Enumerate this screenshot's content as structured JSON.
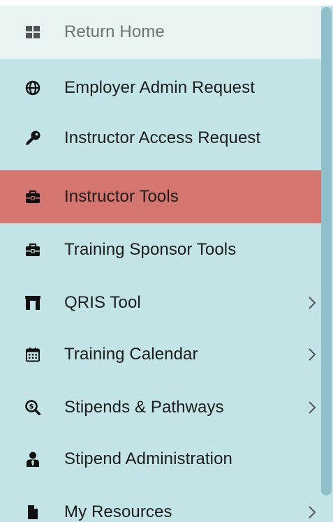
{
  "colors": {
    "menu_bg": "#c3e4e6",
    "home_bg": "#e8f3f4",
    "active_bg": "#d57570",
    "text": "#1c1c1c",
    "home_text": "#6e7475",
    "scrollbar_thumb": "#8fc0c9"
  },
  "menu": {
    "items": [
      {
        "label": "Return Home",
        "icon": "grid-icon",
        "state": "home"
      },
      {
        "label": "Employer Admin Request",
        "icon": "globe-icon"
      },
      {
        "label": "Instructor Access Request",
        "icon": "key-icon"
      },
      {
        "label": "Instructor Tools",
        "icon": "toolbox-icon",
        "state": "active"
      },
      {
        "label": "Training Sponsor Tools",
        "icon": "toolbox-icon"
      },
      {
        "label": "QRIS Tool",
        "icon": "archway-icon",
        "has_submenu": true
      },
      {
        "label": "Training Calendar",
        "icon": "calendar-icon",
        "has_submenu": true
      },
      {
        "label": "Stipends & Pathways",
        "icon": "search-dollar-icon",
        "has_submenu": true
      },
      {
        "label": "Stipend Administration",
        "icon": "user-tie-icon"
      },
      {
        "label": "My Resources",
        "icon": "file-icon",
        "has_submenu": true
      }
    ]
  }
}
